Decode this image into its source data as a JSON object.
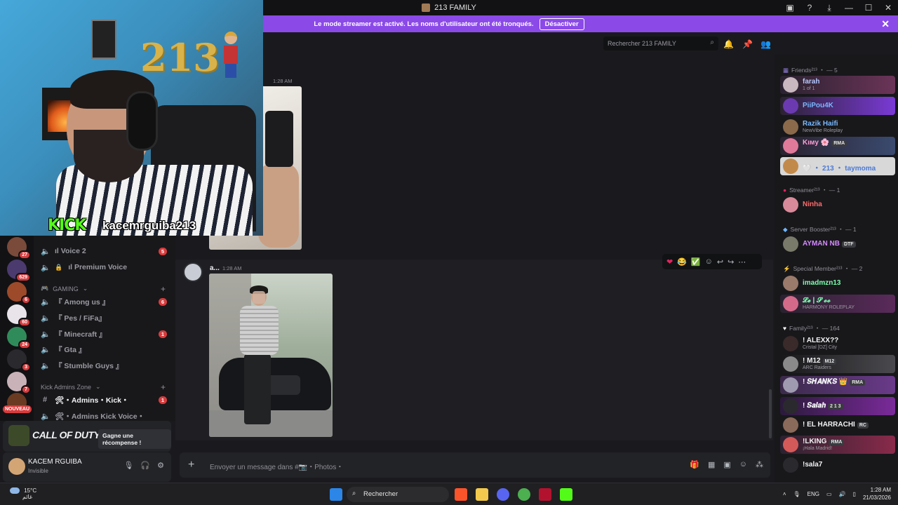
{
  "window": {
    "title": "213 FAMILY"
  },
  "banner": {
    "text": "Le mode streamer est activé. Les noms d'utilisateur ont été tronqués.",
    "button": "Désactiver"
  },
  "search": {
    "placeholder": "Rechercher 213 FAMILY"
  },
  "overlay": {
    "balloon": "213",
    "kick_logo": "KICK",
    "kick_name": "kacemrguiba213"
  },
  "rail": {
    "badges": [
      "27",
      "629",
      "6",
      "60",
      "24",
      "3",
      "7"
    ],
    "new_label": "NOUVEAU"
  },
  "channels": {
    "items": [
      {
        "label": "ıl Voice 2",
        "badge": "5"
      },
      {
        "label": "ıl Premium Voice",
        "badge": ""
      }
    ],
    "gaming_category": "GAMING",
    "gaming": [
      {
        "label": "『 Among us 』",
        "badge": "6"
      },
      {
        "label": "『 Pes / FiFa』",
        "badge": ""
      },
      {
        "label": "『 Minecraft 』",
        "badge": "1"
      },
      {
        "label": "『 Gta 』",
        "badge": ""
      },
      {
        "label": "『 Stumble Guys 』",
        "badge": ""
      }
    ],
    "kick_category": "Kick Admins Zone",
    "kick": [
      {
        "label": "🛠・Admins・Kick・",
        "badge": "1"
      },
      {
        "label": "🛠・Admins Kick Voice・",
        "badge": ""
      }
    ]
  },
  "messages": {
    "time1": "1:28 AM",
    "author2": "a...",
    "time2": "1:28 AM"
  },
  "composer": {
    "placeholder": "Envoyer un message dans #📷・Photos・"
  },
  "promo": {
    "game": "CALL OF DUTY",
    "reward": "Gagne une récompense !"
  },
  "user": {
    "name": "KACEM RGUIBA",
    "status": "Invisible"
  },
  "members": {
    "cats": [
      {
        "label": "Friends²¹³ ・ — 5"
      },
      {
        "label": "Streamer²¹³ ・ — 1"
      },
      {
        "label": "Server Booster²¹³ ・ — 1"
      },
      {
        "label": "Special Member²¹³ ・ — 2"
      },
      {
        "label": "Family²¹³ ・ — 164"
      }
    ],
    "rows": [
      {
        "name": "farah",
        "sub": "1 of 1",
        "color": "#b5c8ff"
      },
      {
        "name": "PiiPou4K",
        "sub": "",
        "color": "#7ab8ff"
      },
      {
        "name": "Razik Haifi",
        "sub": "NewVibe Roleplay",
        "color": "#7ab8ff"
      },
      {
        "name": "Kιмy 🌸",
        "sub": "",
        "color": "#ff9fd6",
        "tag": "RMA"
      },
      {
        "name": "🤍 ・ 213 ・ taymoma",
        "sub": "",
        "color": "#7ab8ff"
      },
      {
        "name": "Ninha",
        "sub": "",
        "color": "#ff6b6b"
      },
      {
        "name": "AYMAN NB",
        "sub": "",
        "color": "#d58bff",
        "tag": "DTF"
      },
      {
        "name": "imadmzn13",
        "sub": "",
        "color": "#7dffb0"
      },
      {
        "name": "𝓛𝓮 | 𝓢 𝓸𝓸",
        "sub": "HARMONY ROLEPLAY",
        "color": "#7dffb0"
      },
      {
        "name": "! ALEXX??",
        "sub": "Cristal [DZ] City",
        "color": "#f2f3f5"
      },
      {
        "name": "! M12",
        "sub": "ARC Raiders",
        "color": "#f2f3f5",
        "tag": "M12"
      },
      {
        "name": "! 𝑺𝑯𝑨𝑵𝑲𝑺 👑",
        "sub": "",
        "color": "#f2f3f5",
        "tag": "RMA"
      },
      {
        "name": "! 𝑺𝒂𝒍𝒂𝒉",
        "sub": "",
        "color": "#f2f3f5",
        "tag": "2 1 3"
      },
      {
        "name": "! EL HARRACHI",
        "sub": "",
        "color": "#f2f3f5",
        "tag": "RC"
      },
      {
        "name": "!LKING",
        "sub": "¡Hala Madrid!",
        "color": "#f2f3f5",
        "tag": "RMA"
      },
      {
        "name": "!sala7",
        "sub": "",
        "color": "#f2f3f5"
      }
    ]
  },
  "taskbar": {
    "temp": "15°C",
    "weather": "غائم",
    "search": "Rechercher",
    "lang": "ENG",
    "time": "1:28 AM",
    "date": "21/03/2026"
  }
}
